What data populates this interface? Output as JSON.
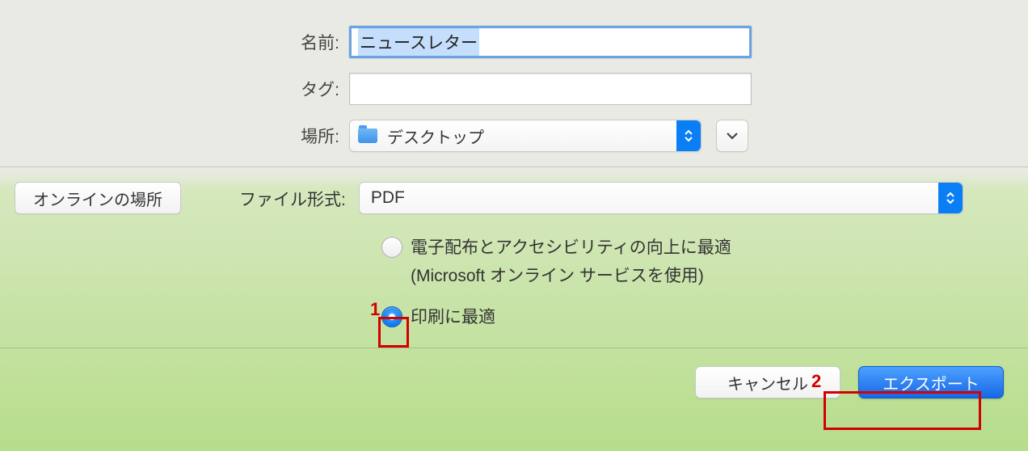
{
  "top": {
    "name_label": "名前:",
    "name_value": "ニュースレター",
    "tags_label": "タグ:",
    "tags_value": "",
    "location_label": "場所:",
    "location_value": "デスクトップ"
  },
  "online_locations_label": "オンラインの場所",
  "file_format": {
    "label": "ファイル形式:",
    "value": "PDF"
  },
  "radios": {
    "opt1_line1": "電子配布とアクセシビリティの向上に最適",
    "opt1_line2": "(Microsoft オンライン サービスを使用)",
    "opt2": "印刷に最適",
    "selected": "opt2"
  },
  "buttons": {
    "cancel": "キャンセル",
    "export": "エクスポート"
  },
  "annotations": {
    "num1": "1",
    "num2": "2"
  }
}
